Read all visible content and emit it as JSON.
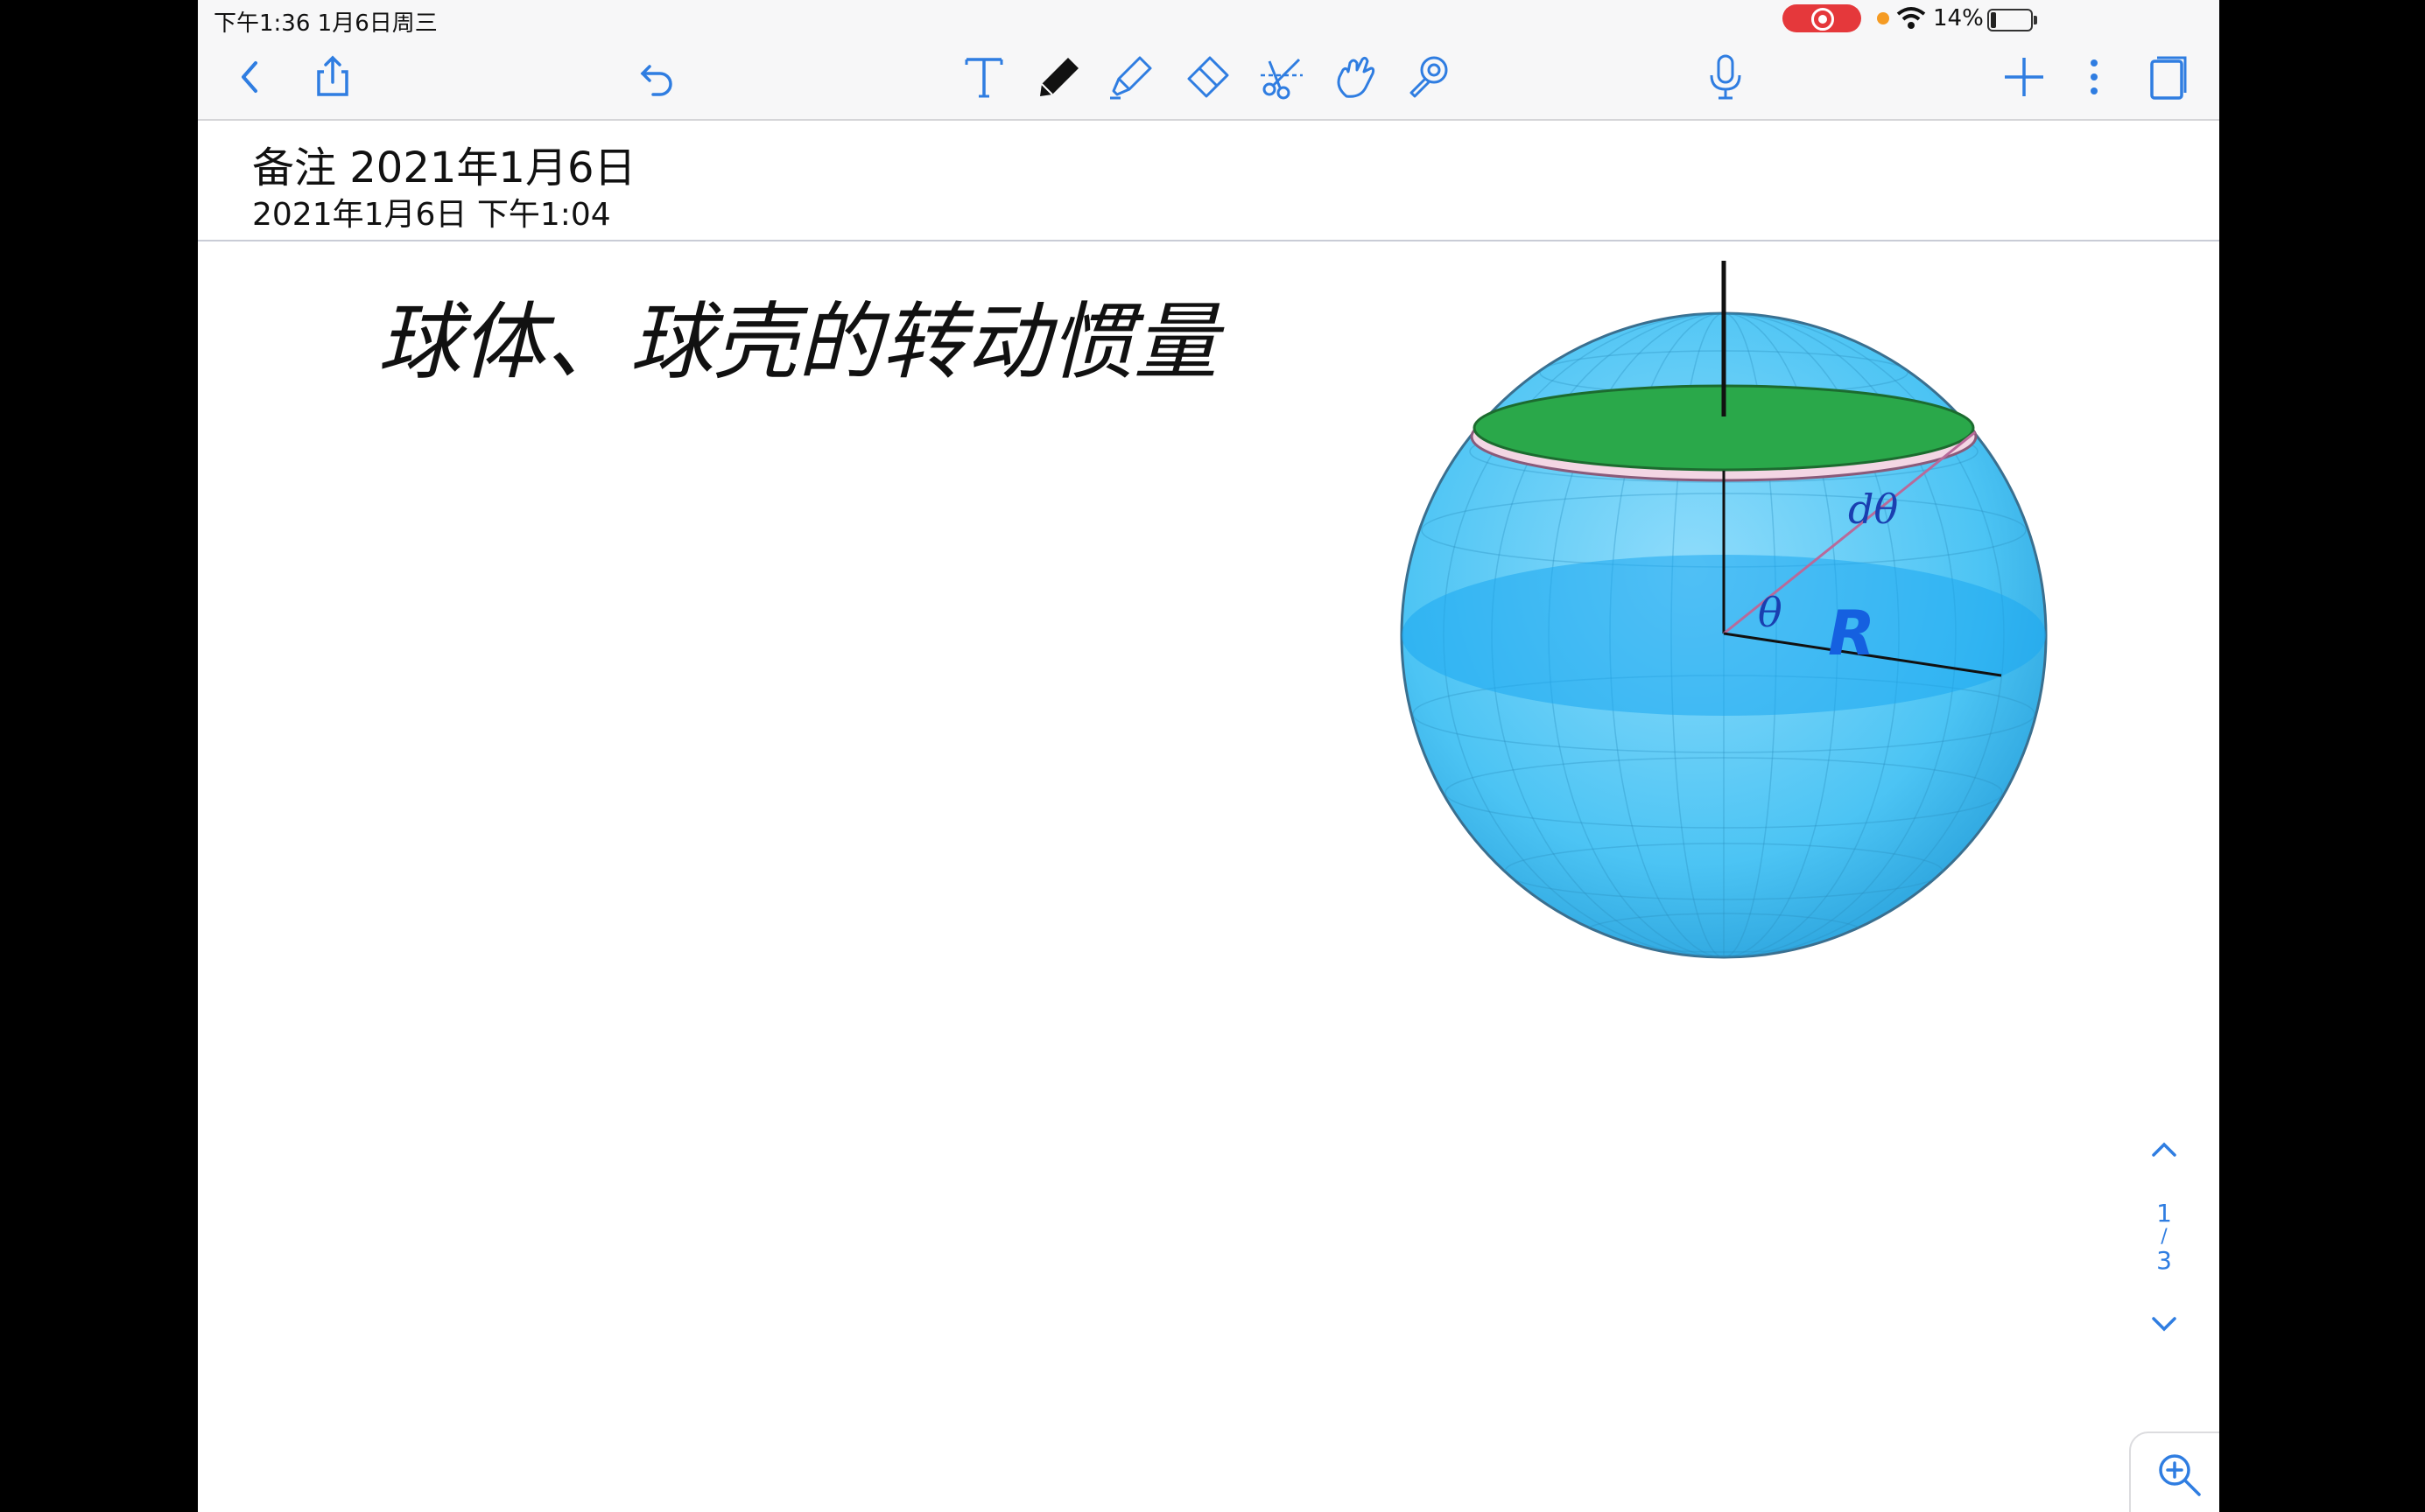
{
  "status_bar": {
    "time": "下午1:36   1月6日周三",
    "battery": "14%",
    "colors": {
      "record": "#e5383b",
      "mic_dot": "#f59b23"
    }
  },
  "toolbar": {
    "left": [
      "back-icon",
      "share-icon",
      "undo-icon"
    ],
    "tools": [
      "text-tool-icon",
      "pen-tool-icon",
      "highlighter-tool-icon",
      "eraser-tool-icon",
      "lasso-scissors-icon",
      "hand-pointer-icon",
      "laser-pointer-icon"
    ],
    "right": [
      "microphone-icon",
      "add-icon",
      "more-icon",
      "pages-icon"
    ],
    "accent": "#2f7de1"
  },
  "note": {
    "title": "备注 2021年1月6日",
    "date": "2021年1月6日 下午1:04"
  },
  "canvas": {
    "handwriting": "球体、球壳的转动惯量",
    "figure_labels": {
      "dtheta": "dθ",
      "theta": "θ",
      "radius": "R"
    },
    "colors": {
      "sphere": "#4cc4f4",
      "disk": "#2aa84a",
      "ring": "#f3d6e4",
      "ink": "#111111",
      "label": "#1a3fb0"
    }
  },
  "pager": {
    "current": "1",
    "separator": "/",
    "total": "3"
  }
}
